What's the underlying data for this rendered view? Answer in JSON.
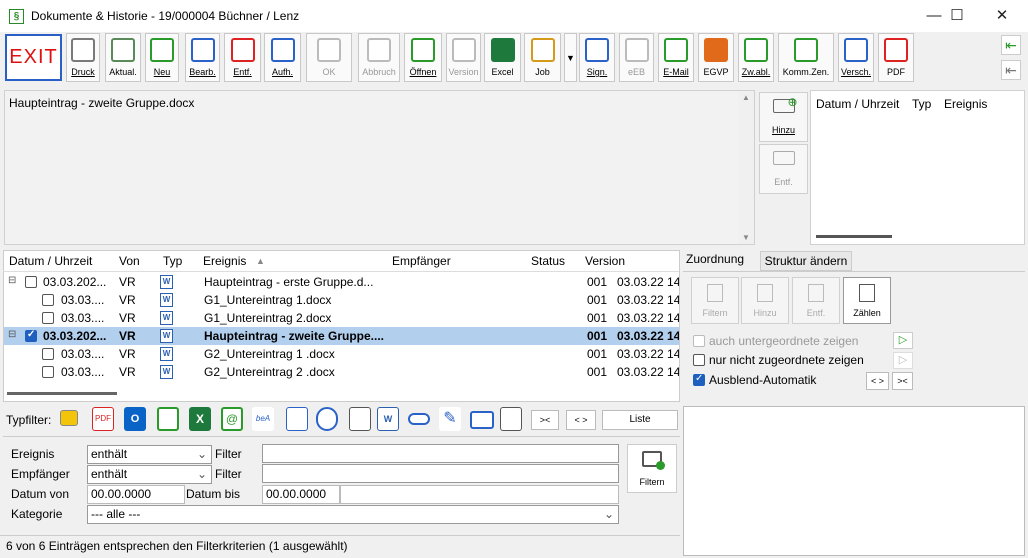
{
  "window": {
    "title": "Dokumente & Historie - 19/000004 Büchner / Lenz",
    "app_icon": "§",
    "minimize": "—",
    "maximize": "☐",
    "close": "✕"
  },
  "toolbar": {
    "exit": "EXIT",
    "buttons": [
      {
        "label": "Druck",
        "icon": "printer-icon",
        "color": "#7a7a7a"
      },
      {
        "label": "Aktual.",
        "icon": "refresh-icon",
        "color": "#5a8a5a"
      },
      {
        "label": "Neu",
        "icon": "plus-icon",
        "color": "#2a9a2a"
      },
      {
        "label": "Bearb.",
        "icon": "pencil-icon",
        "color": "#2a62c8"
      },
      {
        "label": "Entf.",
        "icon": "delete-icon",
        "color": "#d22"
      },
      {
        "label": "Aufh.",
        "icon": "split-icon",
        "color": "#2a62c8"
      },
      {
        "label": "OK",
        "icon": "check-icon",
        "color": "#bbb"
      },
      {
        "label": "Abbruch",
        "icon": "cancel-icon",
        "color": "#bbb"
      },
      {
        "label": "Öffnen",
        "icon": "open-doc-icon",
        "color": "#2a9a2a"
      },
      {
        "label": "Version",
        "icon": "version-icon",
        "color": "#bbb"
      },
      {
        "label": "Excel",
        "icon": "excel-icon",
        "color": "#1e7a3c"
      },
      {
        "label": "Job",
        "icon": "job-icon",
        "color": "#d49a1a"
      },
      {
        "label": "Sign.",
        "icon": "sign-icon",
        "color": "#2a62c8"
      },
      {
        "label": "eEB",
        "icon": "eeb-icon",
        "color": "#bbb"
      },
      {
        "label": "E-Mail",
        "icon": "email-icon",
        "color": "#2a9a2a"
      },
      {
        "label": "EGVP",
        "icon": "egvp-icon",
        "color": "#e06a1a"
      },
      {
        "label": "Zw.abl.",
        "icon": "clipboard-icon",
        "color": "#2a9a2a"
      },
      {
        "label": "Komm.Zen.",
        "icon": "komm-icon",
        "color": "#2a9a2a"
      },
      {
        "label": "Versch.",
        "icon": "folder-search-icon",
        "color": "#2a62c8"
      },
      {
        "label": "PDF",
        "icon": "pdf-icon",
        "color": "#d22"
      }
    ],
    "job_dropdown": "▼"
  },
  "document": {
    "title": "Haupteintrag - zweite Gruppe.docx",
    "side_add": "Hinzu",
    "side_remove": "Entf."
  },
  "history": {
    "columns": [
      "Datum / Uhrzeit",
      "Typ",
      "Ereignis"
    ]
  },
  "table": {
    "columns": [
      "Datum / Uhrzeit",
      "Von",
      "Typ",
      "Ereignis",
      "Empfänger",
      "Status",
      "Version"
    ],
    "sort_indicator": "▲",
    "rows": [
      {
        "date": "03.03.202...",
        "von": "VR",
        "ereignis": "Haupteintrag - erste Gruppe.d...",
        "version": "001",
        "vdate": "03.03.22 14",
        "level": 0,
        "checked": false,
        "selected": false
      },
      {
        "date": "03.03....",
        "von": "VR",
        "ereignis": "G1_Untereintrag 1.docx",
        "version": "001",
        "vdate": "03.03.22 14",
        "level": 1,
        "checked": false,
        "selected": false
      },
      {
        "date": "03.03....",
        "von": "VR",
        "ereignis": "G1_Untereintrag 2.docx",
        "version": "001",
        "vdate": "03.03.22 14",
        "level": 1,
        "checked": false,
        "selected": false
      },
      {
        "date": "03.03.202...",
        "von": "VR",
        "ereignis": "Haupteintrag - zweite Gruppe....",
        "version": "001",
        "vdate": "03.03.22 14",
        "level": 0,
        "checked": true,
        "selected": true
      },
      {
        "date": "03.03....",
        "von": "VR",
        "ereignis": "G2_Untereintrag 1 .docx",
        "version": "001",
        "vdate": "03.03.22 14",
        "level": 1,
        "checked": false,
        "selected": false
      },
      {
        "date": "03.03....",
        "von": "VR",
        "ereignis": "G2_Untereintrag 2 .docx",
        "version": "001",
        "vdate": "03.03.22 14",
        "level": 1,
        "checked": false,
        "selected": false
      }
    ]
  },
  "typfilter": {
    "label": "Typfilter:",
    "collapse": ">< ",
    "expand": "< >",
    "list": "Liste"
  },
  "filter": {
    "ereignis_label": "Ereignis",
    "ereignis_op": "enthält",
    "empfaenger_label": "Empfänger",
    "empfaenger_op": "enthält",
    "filter_label": "Filter",
    "datum_von_label": "Datum von",
    "datum_von": "00.00.0000",
    "datum_bis_label": "Datum bis",
    "datum_bis": "00.00.0000",
    "kategorie_label": "Kategorie",
    "kategorie": "--- alle ---",
    "filter_button": "Filtern"
  },
  "zuordnung": {
    "tab1": "Zuordnung",
    "tab2": "Struktur ändern",
    "btn_filtern": "Filtern",
    "btn_hinzu": "Hinzu",
    "btn_entf": "Entf.",
    "btn_zaehlen": "Zählen",
    "opt1": "auch untergeordnete zeigen",
    "opt2": "nur nicht zugeordnete zeigen",
    "opt3": "Ausblend-Automatik",
    "btn_expand": "< >",
    "btn_collapse": "><"
  },
  "status": {
    "text": "6 von 6 Einträgen entsprechen den Filterkriterien (1 ausgewählt)"
  }
}
